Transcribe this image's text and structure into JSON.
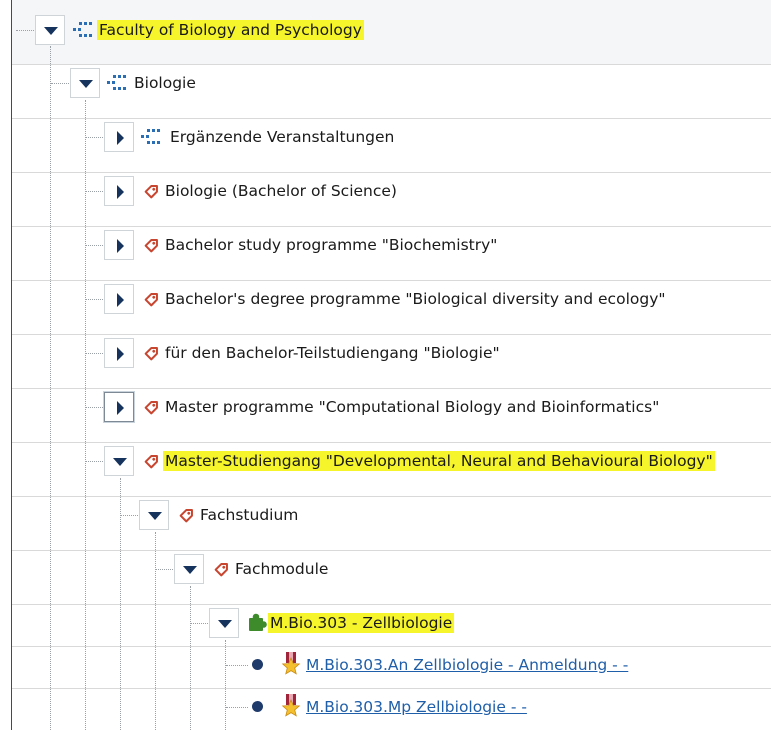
{
  "colors": {
    "highlight": "#f6f52c",
    "toggle_arrow": "#16335e",
    "org_icon": "#2a6eb5",
    "tag_icon": "#c8452f",
    "module_icon": "#3d8b2a",
    "link": "#1f5ea8",
    "bullet": "#1f3b6b"
  },
  "tree": {
    "root": {
      "label": "Faculty of Biology and Psychology",
      "icon": "org-unit-icon",
      "expanded": true,
      "highlighted": true
    },
    "biologie": {
      "label": "Biologie",
      "icon": "org-unit-icon",
      "expanded": true
    },
    "items": [
      {
        "label": "Ergänzende Veranstaltungen",
        "icon": "org-unit-icon",
        "expanded": false
      },
      {
        "label": "Biologie (Bachelor of Science)",
        "icon": "tag-icon",
        "expanded": false
      },
      {
        "label": "Bachelor study programme \"Biochemistry\"",
        "icon": "tag-icon",
        "expanded": false
      },
      {
        "label": "Bachelor's degree programme \"Biological diversity and ecology\"",
        "icon": "tag-icon",
        "expanded": false
      },
      {
        "label": "für den Bachelor-Teilstudiengang \"Biologie\"",
        "icon": "tag-icon",
        "expanded": false
      },
      {
        "label": "Master programme \"Computational Biology and Bioinformatics\"",
        "icon": "tag-icon",
        "expanded": false,
        "focused": true
      }
    ],
    "master": {
      "label": "Master-Studiengang \"Developmental, Neural and Behavioural Biology\"",
      "icon": "tag-icon",
      "expanded": true,
      "highlighted": true
    },
    "fachstudium": {
      "label": "Fachstudium",
      "icon": "tag-icon",
      "expanded": true
    },
    "fachmodule": {
      "label": "Fachmodule",
      "icon": "tag-icon",
      "expanded": true
    },
    "module": {
      "label": "M.Bio.303 - Zellbiologie",
      "icon": "puzzle-piece-icon",
      "expanded": true,
      "highlighted": true
    },
    "events": [
      {
        "label": "M.Bio.303.An Zellbiologie - Anmeldung - -",
        "icon": "star-ribbon-icon"
      },
      {
        "label": "M.Bio.303.Mp Zellbiologie - -",
        "icon": "star-ribbon-icon"
      }
    ]
  }
}
